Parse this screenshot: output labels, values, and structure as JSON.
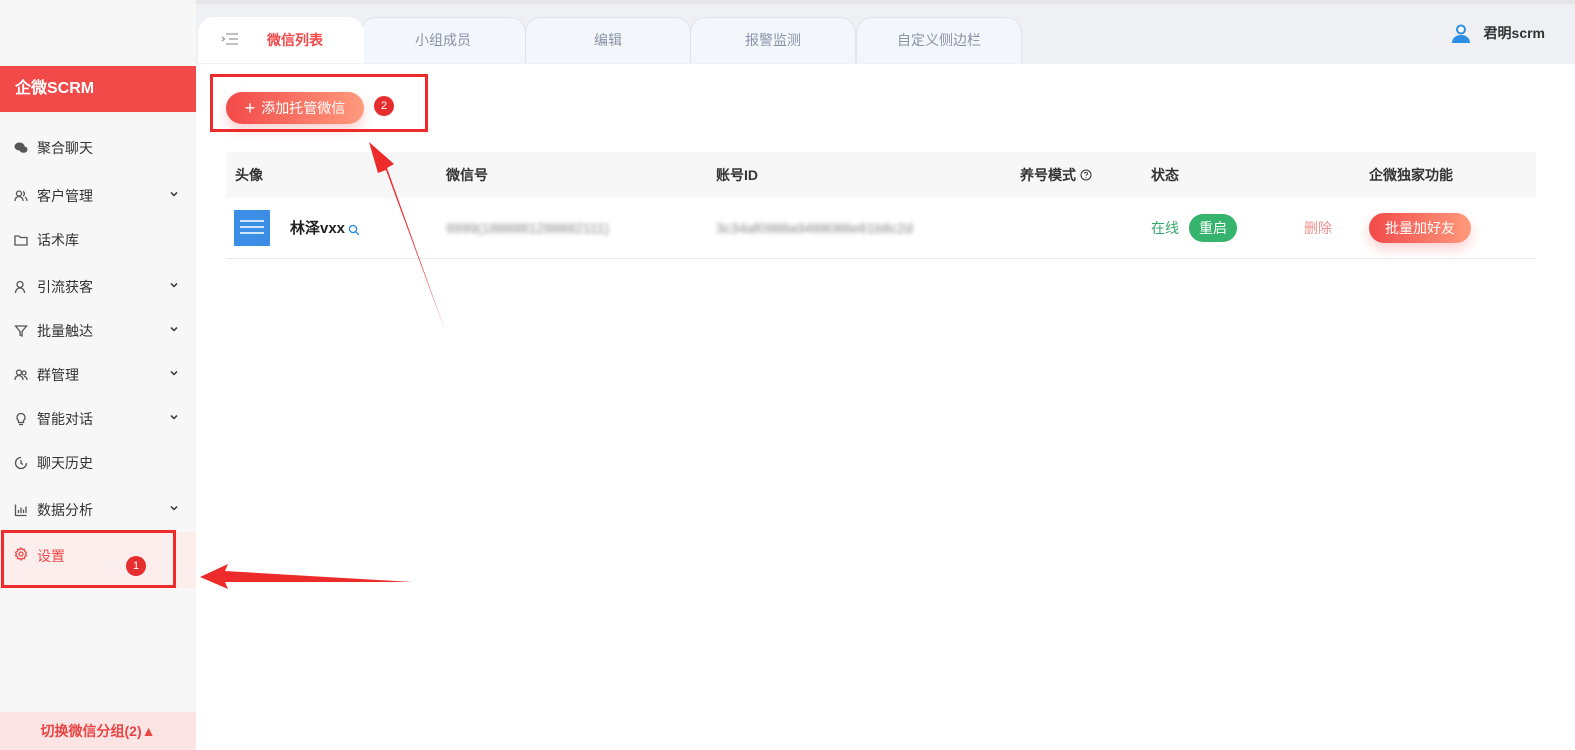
{
  "brand": {
    "name": "企微SCRM"
  },
  "sidebar": {
    "items": [
      {
        "label": "聚合聊天",
        "icon": "wechat-icon",
        "has_children": false
      },
      {
        "label": "客户管理",
        "icon": "customers-icon",
        "has_children": true
      },
      {
        "label": "话术库",
        "icon": "folder-icon",
        "has_children": false
      },
      {
        "label": "引流获客",
        "icon": "user-icon",
        "has_children": true
      },
      {
        "label": "批量触达",
        "icon": "funnel-icon",
        "has_children": true
      },
      {
        "label": "群管理",
        "icon": "group-icon",
        "has_children": true
      },
      {
        "label": "智能对话",
        "icon": "bulb-icon",
        "has_children": true
      },
      {
        "label": "聊天历史",
        "icon": "history-icon",
        "has_children": false
      },
      {
        "label": "数据分析",
        "icon": "chart-icon",
        "has_children": true
      },
      {
        "label": "设置",
        "icon": "gear-icon",
        "has_children": false,
        "active": true
      }
    ],
    "switch_group": "切换微信分组(2)▲"
  },
  "tabs": [
    {
      "label": "微信列表",
      "active": true
    },
    {
      "label": "小组成员"
    },
    {
      "label": "编辑"
    },
    {
      "label": "报警监测"
    },
    {
      "label": "自定义侧边栏"
    }
  ],
  "user": {
    "name": "君明scrm"
  },
  "toolbar": {
    "add_label": "添加托管微信"
  },
  "annotations": {
    "badge1": "1",
    "badge2": "2"
  },
  "table": {
    "headers": {
      "avatar": "头像",
      "wechat_id": "微信号",
      "account_id": "账号ID",
      "mode": "养号模式",
      "status": "状态",
      "exclusive": "企微独家功能"
    },
    "rows": [
      {
        "nickname": "林泽vxx",
        "wechat_id": "9999(1888881288882111)",
        "account_id": "3c34af0988a9488088e61b8c2d",
        "status": "在线",
        "restart": "重启",
        "delete": "删除",
        "batch_add": "批量加好友"
      }
    ]
  },
  "colors": {
    "accent": "#f24949",
    "online": "#36b36d",
    "sidebar_bg": "#f7f7f8"
  }
}
